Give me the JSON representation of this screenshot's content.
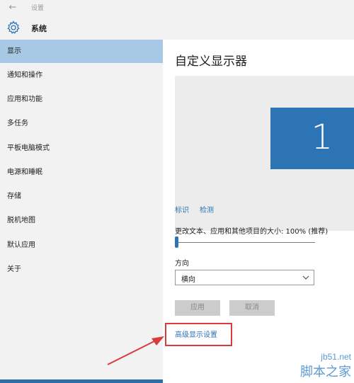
{
  "titlebar": {
    "back_icon": "back-arrow-icon",
    "title": "设置"
  },
  "header": {
    "icon": "gear-icon",
    "title": "系统"
  },
  "sidebar": {
    "items": [
      {
        "label": "显示",
        "selected": true
      },
      {
        "label": "通知和操作",
        "selected": false
      },
      {
        "label": "应用和功能",
        "selected": false
      },
      {
        "label": "多任务",
        "selected": false
      },
      {
        "label": "平板电脑模式",
        "selected": false
      },
      {
        "label": "电源和睡眠",
        "selected": false
      },
      {
        "label": "存储",
        "selected": false
      },
      {
        "label": "脱机地图",
        "selected": false
      },
      {
        "label": "默认应用",
        "selected": false
      },
      {
        "label": "关于",
        "selected": false
      }
    ]
  },
  "main": {
    "title": "自定义显示器",
    "monitor_number": "1",
    "identify_link": "标识",
    "detect_link": "检测",
    "scale_label": "更改文本、应用和其他项目的大小: 100% (推荐)",
    "scale_value_percent": 100,
    "orientation_label": "方向",
    "orientation_value": "横向",
    "apply_button": "应用",
    "cancel_button": "取消",
    "advanced_link": "高级显示设置"
  },
  "watermark": {
    "url": "jb51.net",
    "name": "脚本之家"
  },
  "colors": {
    "accent": "#2d74b5",
    "selected_bg": "#a7c9e6",
    "highlight": "#d83b3b"
  }
}
